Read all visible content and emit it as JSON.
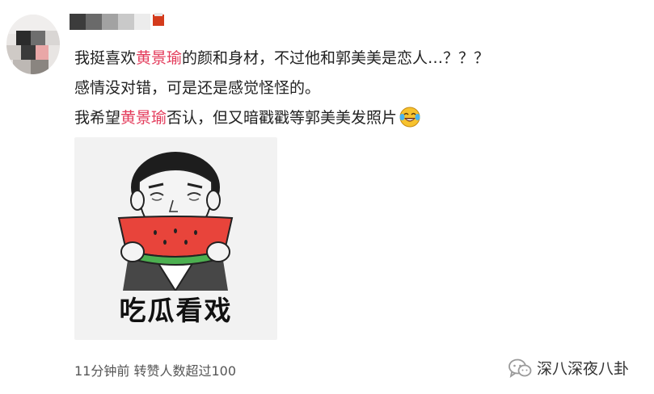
{
  "comment": {
    "line1": {
      "before": "我挺喜欢",
      "highlight": "黄景瑜",
      "after": "的颜和身材，不过他和郭美美是恋人…？？？"
    },
    "line2": "感情没对错，可是还是感觉怪怪的。",
    "line3": {
      "before": "我希望",
      "highlight": "黄景瑜",
      "after": "否认，但又暗戳戳等郭美美发照片"
    },
    "emoji": "laugh-cry-emoji-icon"
  },
  "sticker": {
    "caption": "吃瓜看戏"
  },
  "meta": {
    "time": "11分钟前",
    "reposts": "转赞人数超过100"
  },
  "watermark": {
    "text": "深八深夜八卦",
    "icon": "wechat-icon"
  },
  "colors": {
    "highlight": "#e33a5a",
    "meta_text": "#555555",
    "sticker_bg": "#f2f2f2"
  }
}
